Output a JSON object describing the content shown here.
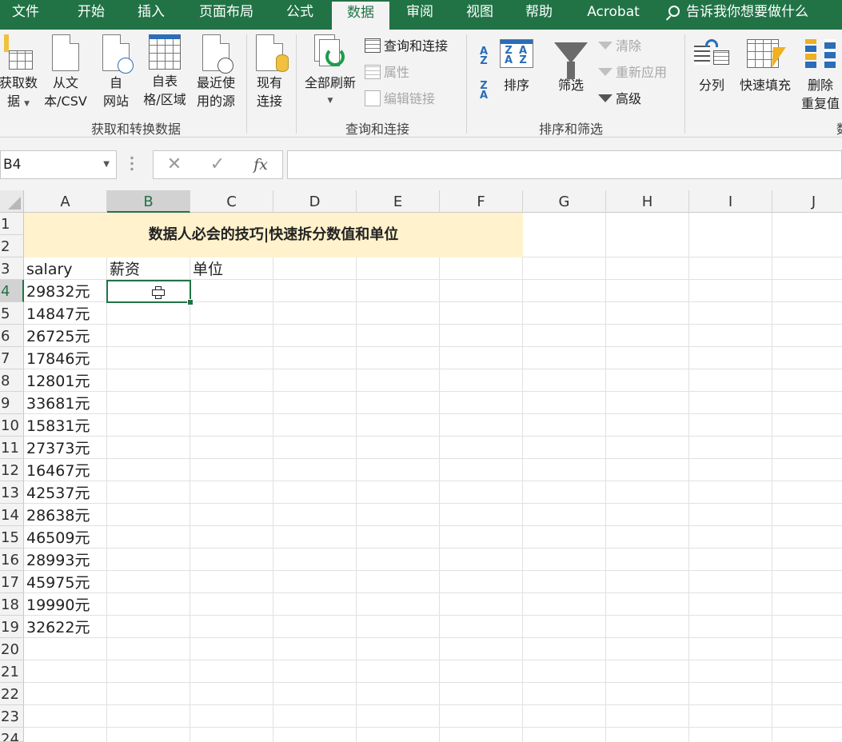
{
  "ribbon_tabs": [
    "文件",
    "开始",
    "插入",
    "页面布局",
    "公式",
    "数据",
    "审阅",
    "视图",
    "帮助",
    "Acrobat"
  ],
  "active_tab": "数据",
  "tell_me": "告诉我你想要做什么",
  "groups": {
    "get_transform": {
      "label": "获取和转换数据",
      "get_data": [
        "获取数",
        "据"
      ],
      "from_text": [
        "从文",
        "本/CSV"
      ],
      "from_web": [
        "自",
        "网站"
      ],
      "from_table": [
        "自表",
        "格/区域"
      ],
      "recent_sources": [
        "最近使",
        "用的源"
      ],
      "existing": [
        "现有",
        "连接"
      ]
    },
    "queries": {
      "label": "查询和连接",
      "refresh_all": "全部刷新",
      "queries_connections": "查询和连接",
      "properties": "属性",
      "edit_links": "编辑链接"
    },
    "sort_filter": {
      "label": "排序和筛选",
      "sort": "排序",
      "filter": "筛选",
      "clear": "清除",
      "reapply": "重新应用",
      "advanced": "高级"
    },
    "data_tools": {
      "label": "数",
      "text_to_columns": "分列",
      "flash_fill": "快速填充",
      "remove_duplicates": [
        "删除",
        "重复值"
      ]
    }
  },
  "name_box": "B4",
  "formula": "",
  "columns": [
    "A",
    "B",
    "C",
    "D",
    "E",
    "F",
    "G",
    "H",
    "I",
    "J"
  ],
  "rows": [
    "1",
    "2",
    "3",
    "4",
    "5",
    "6",
    "7",
    "8",
    "9",
    "10",
    "11",
    "12",
    "13",
    "14",
    "15",
    "16",
    "17",
    "18",
    "19",
    "20",
    "21",
    "22",
    "23",
    "24"
  ],
  "sheet_title": "数据人必会的技巧|快速拆分数值和单位",
  "headers": {
    "a": "salary",
    "b": "薪资",
    "c": "单位"
  },
  "salary_values": [
    "29832元",
    "14847元",
    "26725元",
    "17846元",
    "12801元",
    "33681元",
    "15831元",
    "27373元",
    "16467元",
    "42537元",
    "28638元",
    "46509元",
    "28993元",
    "45975元",
    "19990元",
    "32622元"
  ],
  "colors": {
    "excel_green": "#217346",
    "title_fill": "#fff2cc"
  }
}
